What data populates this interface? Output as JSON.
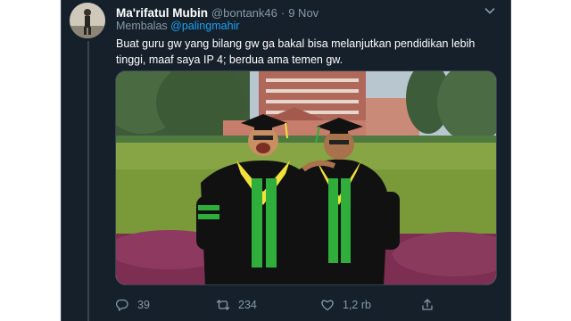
{
  "tweet": {
    "author_name": "Ma'rifatul Mubin",
    "author_handle": "@bontank46",
    "separator": "·",
    "date": "9 Nov",
    "reply_prefix": "Membalas",
    "reply_to": "@palingmahir",
    "text": "Buat guru gw yang bilang gw ga bakal bisa melanjutkan pendidikan lebih tinggi, maaf saya IP 4; berdua ama temen gw."
  },
  "actions": {
    "reply_count": "39",
    "retweet_count": "234",
    "like_count": "1,2 rb"
  },
  "icons": {
    "more": "chevron-down-icon",
    "reply": "reply-bubble-icon",
    "retweet": "retweet-icon",
    "like": "heart-icon",
    "share": "share-icon"
  },
  "colors": {
    "background": "#15202b",
    "text_primary": "#ffffff",
    "text_secondary": "#8899a6",
    "link": "#1da1f2",
    "border": "#38444d",
    "gown": "#111111",
    "sash_green": "#2fae3c",
    "sash_yellow": "#f2e23a"
  }
}
